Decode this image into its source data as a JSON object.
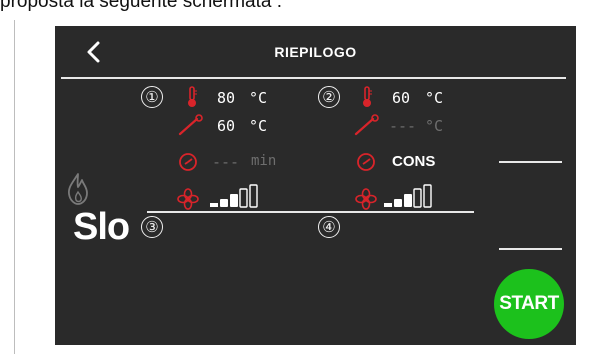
{
  "caption": "proposta la seguente schermata :",
  "header": {
    "title": "RIEPILOGO"
  },
  "programs": [
    {
      "number": "①",
      "temp": "80",
      "temp_unit": "°C",
      "probe": "60",
      "probe_unit": "°C",
      "time": "---",
      "time_unit": "min",
      "fan_level": 2
    },
    {
      "number": "②",
      "temp": "60",
      "temp_unit": "°C",
      "probe": "---",
      "probe_unit": "°C",
      "time": "CONS",
      "fan_level": 2
    }
  ],
  "phases": {
    "three": "③",
    "four": "④"
  },
  "mode_label": "Slo",
  "start_label": "START",
  "colors": {
    "background": "#2a2a2a",
    "accent_red": "#d9242a",
    "start_green": "#1cc11c"
  },
  "icons": [
    "back-chevron-icon",
    "thermometer-icon",
    "probe-icon",
    "timer-icon",
    "fan-icon",
    "fan-speed-icon",
    "flame-icon"
  ]
}
